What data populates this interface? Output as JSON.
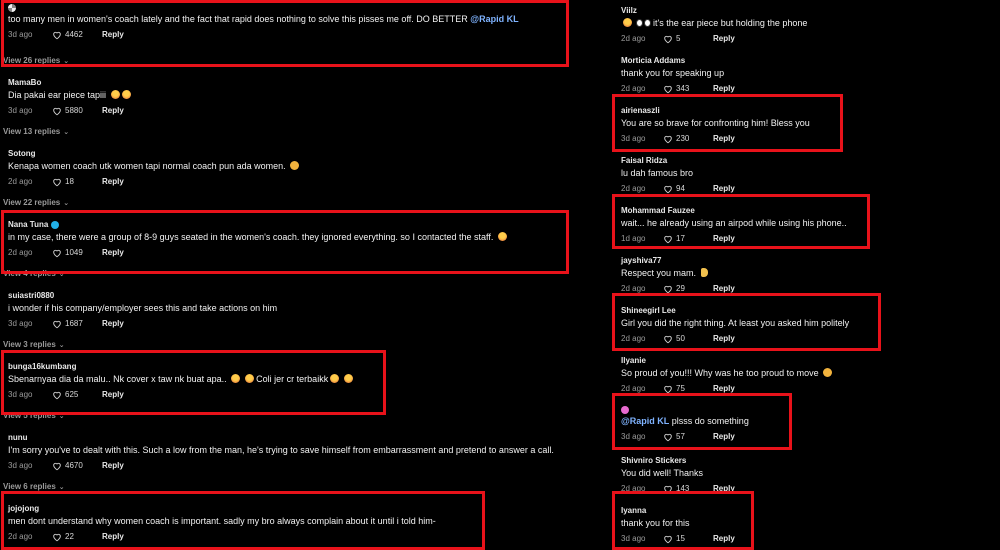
{
  "colors": {
    "background": "#000000",
    "highlight": "#e8121a",
    "mention": "#7fb3ff"
  },
  "left_comments": [
    {
      "user": "",
      "user_icon": "wheel-avatar-icon",
      "text": "too many men in women's coach lately and the fact that rapid does nothing to solve this pisses me off. DO BETTER ",
      "mention": "@Rapid KL",
      "time": "3d ago",
      "likes": "4462",
      "reply": "Reply"
    },
    {
      "user": "MamaBo",
      "text": "Dia pakai ear piece tapiii",
      "emojis": 2,
      "time": "3d ago",
      "likes": "5880",
      "reply": "Reply"
    },
    {
      "user": "Sotong",
      "text": "Kenapa women coach utk women tapi normal coach pun ada women.",
      "emojis": 1,
      "time": "2d ago",
      "likes": "18",
      "reply": "Reply"
    },
    {
      "user": "Nana Tuna",
      "verified": true,
      "text": "in my case, there were a group of 8-9 guys seated in the women's coach. they ignored everything. so I contacted the staff.",
      "emojis": 1,
      "time": "2d ago",
      "likes": "1049",
      "reply": "Reply"
    },
    {
      "user": "suiastri0880",
      "text": "i wonder if his company/employer sees this and take actions on him",
      "time": "3d ago",
      "likes": "1687",
      "reply": "Reply"
    },
    {
      "user": "bunga16kumbang",
      "text": "Sbenarnyaa dia da malu.. Nk cover x taw nk buat apa..",
      "text2": "Coli jer cr terbaikk",
      "time": "3d ago",
      "likes": "625",
      "reply": "Reply"
    },
    {
      "user": "nunu",
      "text": "I'm sorry you've to dealt with this. Such a low from the man, he's trying to save himself from embarrassment and pretend to answer a call.",
      "time": "3d ago",
      "likes": "4670",
      "reply": "Reply"
    },
    {
      "user": "jojojong",
      "text": "men dont understand why women coach is important. sadly my bro always complain about it until i told him-",
      "time": "2d ago",
      "likes": "22",
      "reply": "Reply"
    }
  ],
  "left_replies": [
    {
      "label": "View 26 replies"
    },
    {
      "label": "View 13 replies"
    },
    {
      "label": "View 22 replies"
    },
    {
      "label": "View 4 replies"
    },
    {
      "label": "View 3 replies"
    },
    {
      "label": "View 5 replies"
    },
    {
      "label": "View 6 replies"
    }
  ],
  "right_comments": [
    {
      "user": "Viilz",
      "text": "it's the ear piece but holding the phone",
      "time": "2d ago",
      "likes": "5",
      "reply": "Reply"
    },
    {
      "user": "Morticia Addams",
      "text": "thank you for speaking up",
      "time": "2d ago",
      "likes": "343",
      "reply": "Reply"
    },
    {
      "user": "airienaszli",
      "text": "You are so brave for confronting him! Bless you",
      "time": "3d ago",
      "likes": "230",
      "reply": "Reply"
    },
    {
      "user": "Faisal Ridza",
      "text": "lu dah famous bro",
      "time": "2d ago",
      "likes": "94",
      "reply": "Reply"
    },
    {
      "user": "Mohammad Fauzee",
      "text": "wait... he already using an airpod while using his phone..",
      "time": "1d ago",
      "likes": "17",
      "reply": "Reply"
    },
    {
      "user": "jayshiva77",
      "text": "Respect you mam.",
      "time": "2d ago",
      "likes": "29",
      "reply": "Reply"
    },
    {
      "user": "Shineegirl Lee",
      "text": "Girl you did the right thing. At least you asked him politely",
      "time": "2d ago",
      "likes": "50",
      "reply": "Reply"
    },
    {
      "user": "Ilyanie",
      "text": "So proud of you!!! Why was he too proud to move",
      "time": "2d ago",
      "likes": "75",
      "reply": "Reply"
    },
    {
      "user": "",
      "mention": "@Rapid KL",
      "text": " plsss do something",
      "time": "3d ago",
      "likes": "57",
      "reply": "Reply"
    },
    {
      "user": "Shivniro Stickers",
      "text": "You did well! Thanks",
      "time": "2d ago",
      "likes": "143",
      "reply": "Reply"
    },
    {
      "user": "Iyanna",
      "text": "thank you for this",
      "time": "3d ago",
      "likes": "15",
      "reply": "Reply"
    }
  ]
}
